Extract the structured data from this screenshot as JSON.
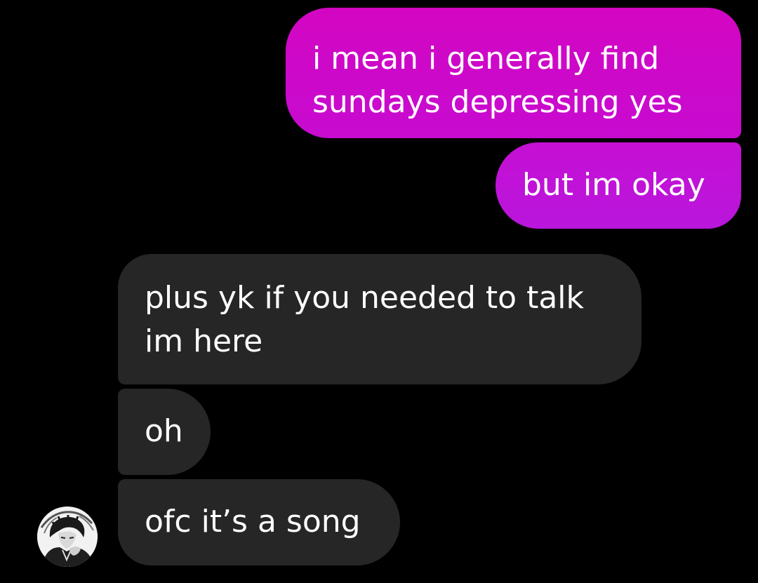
{
  "conversation": {
    "messages": [
      {
        "sender": "me",
        "text": "i mean i generally find\nsundays depressing yes"
      },
      {
        "sender": "me",
        "text": "but im okay"
      },
      {
        "sender": "other",
        "text": "plus yk if you needed to talk\nim here"
      },
      {
        "sender": "other",
        "text": "oh"
      },
      {
        "sender": "other",
        "text": "ofc it’s a song"
      }
    ],
    "contact_avatar": "user-avatar-illustration"
  },
  "colors": {
    "background": "#000000",
    "sent_bubble_top": "#d306c2",
    "sent_bubble_bottom": "#b916dc",
    "received_bubble": "#262626",
    "text": "#ffffff"
  }
}
